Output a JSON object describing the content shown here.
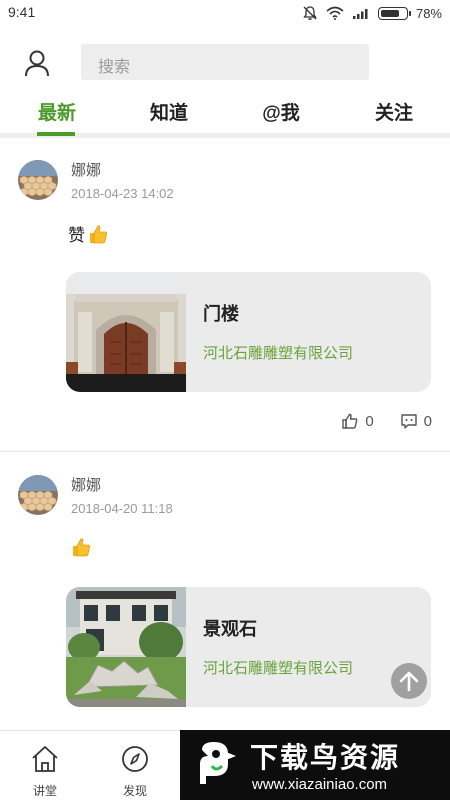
{
  "status_bar": {
    "time": "9:41",
    "battery": "78%",
    "battery_level": 0.78
  },
  "header": {
    "search_placeholder": "搜索"
  },
  "tabs": [
    {
      "label": "最新",
      "active": true
    },
    {
      "label": "知道",
      "active": false
    },
    {
      "label": "@我",
      "active": false
    },
    {
      "label": "关注",
      "active": false
    }
  ],
  "posts": [
    {
      "author": "娜娜",
      "time": "2018-04-23 14:02",
      "text": "赞",
      "emoji": "thumbs-up",
      "card": {
        "title": "门楼",
        "company": "河北石雕雕塑有限公司"
      },
      "likes": "0",
      "comments": "0"
    },
    {
      "author": "娜娜",
      "time": "2018-04-20 11:18",
      "text": "",
      "emoji": "thumbs-up",
      "card": {
        "title": "景观石",
        "company": "河北石雕雕塑有限公司"
      }
    }
  ],
  "bottom_nav": [
    {
      "label": "讲堂",
      "icon": "home-icon"
    },
    {
      "label": "发现",
      "icon": "compass-icon"
    }
  ],
  "watermark": {
    "title": "下载鸟资源",
    "url": "www.xiazainiao.com"
  },
  "colors": {
    "accent": "#4c9a2a",
    "company_text": "#6aa43c"
  }
}
